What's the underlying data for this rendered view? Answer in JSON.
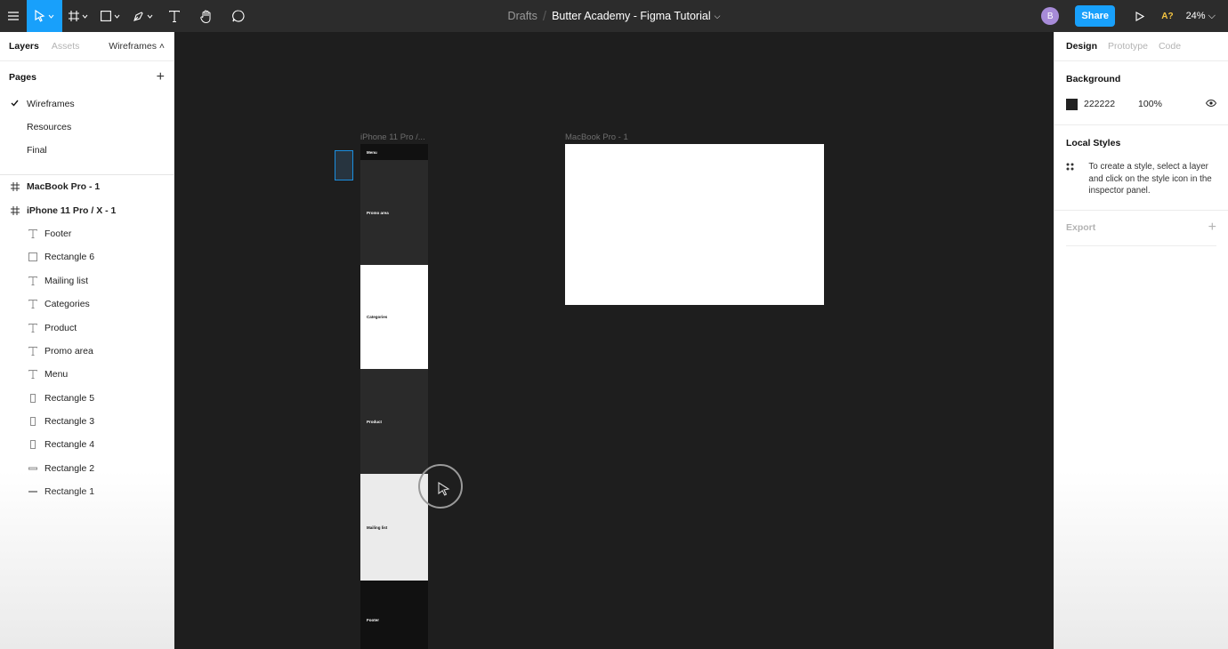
{
  "toolbar": {
    "breadcrumb_drafts": "Drafts",
    "breadcrumb_separator": "/",
    "file_name": "Butter Academy - Figma Tutorial",
    "avatar_initial": "B",
    "share_label": "Share",
    "a_badge": "A?",
    "zoom": "24%"
  },
  "left_panel": {
    "tabs": [
      "Layers",
      "Assets"
    ],
    "page_selector": "Wireframes ˄",
    "pages_title": "Pages",
    "pages": [
      "Wireframes",
      "Resources",
      "Final"
    ],
    "frames": [
      "MacBook Pro - 1",
      "iPhone 11 Pro / X - 1"
    ],
    "children": [
      {
        "label": "Footer",
        "icon": "text-icon"
      },
      {
        "label": "Rectangle 6",
        "icon": "rectangle-icon"
      },
      {
        "label": "Mailing list",
        "icon": "text-icon"
      },
      {
        "label": "Categories",
        "icon": "text-icon"
      },
      {
        "label": "Product",
        "icon": "text-icon"
      },
      {
        "label": "Promo area",
        "icon": "text-icon"
      },
      {
        "label": "Menu",
        "icon": "text-icon"
      },
      {
        "label": "Rectangle 5",
        "icon": "tall-rectangle-icon"
      },
      {
        "label": "Rectangle 3",
        "icon": "tall-rectangle-icon"
      },
      {
        "label": "Rectangle 4",
        "icon": "tall-rectangle-icon"
      },
      {
        "label": "Rectangle 2",
        "icon": "line-rectangle-icon"
      },
      {
        "label": "Rectangle 1",
        "icon": "line-rectangle-icon"
      }
    ]
  },
  "canvas": {
    "iphone_label": "iPhone 11 Pro /...",
    "macbook_label": "MacBook Pro - 1",
    "sections": [
      "Menu",
      "Promo area",
      "Categories",
      "Product",
      "Mailing list",
      "Footer"
    ]
  },
  "right_panel": {
    "tabs": [
      "Design",
      "Prototype",
      "Code"
    ],
    "background_title": "Background",
    "background_hex": "222222",
    "background_opacity": "100%",
    "local_styles_title": "Local Styles",
    "local_styles_hint": "To create a style, select a layer and click on the style icon in the inspector panel.",
    "export_title": "Export"
  },
  "colors": {
    "accent": "#18a0fb",
    "canvas": "#1e1e1e",
    "toolbar": "#2c2c2c"
  }
}
